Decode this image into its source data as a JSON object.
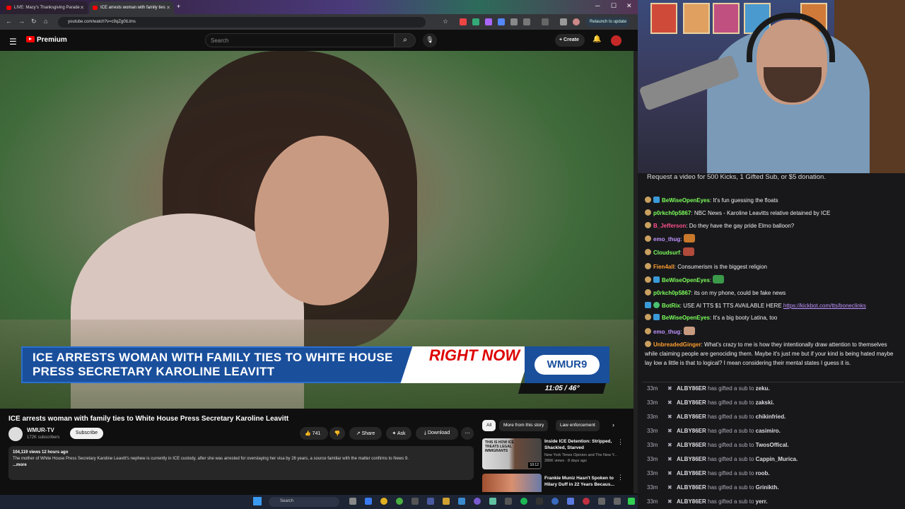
{
  "browser": {
    "tabs": [
      {
        "label": "LIVE: Macy's Thanksgiving Parade"
      },
      {
        "label": "ICE arrests woman with family ties"
      }
    ],
    "url": "youtube.com/watch?v=c9qZg0tLlms",
    "relaunch_label": "Relaunch to update"
  },
  "youtube": {
    "brand": "Premium",
    "search_placeholder": "Search",
    "create_label": "Create",
    "video": {
      "banner_text": "ICE ARRESTS WOMAN WITH FAMILY TIES TO WHITE HOUSE PRESS SECRETARY KAROLINE LEAVITT",
      "right_now": "RIGHT NOW",
      "station": "WMUR9",
      "time_temp": "11:05 / 46°"
    },
    "title": "ICE arrests woman with family ties to White House Press Secretary Karoline Leavitt",
    "channel": {
      "name": "WMUR-TV",
      "subscribers": "172K subscribers",
      "subscribe_label": "Subscribe"
    },
    "actions": {
      "likes": "741",
      "share": "Share",
      "ask": "Ask",
      "download": "Download"
    },
    "description": {
      "meta": "104,119 views  12 hours ago",
      "text": "The mother of White House Press Secretary Karoline Leavitt's nephew is currently in ICE custody, after she was arrested for overstaying her visa by 26 years, a source familiar with the matter confirms to News 9.",
      "more": "...more"
    },
    "chips": [
      "All",
      "More from this story",
      "Law enforcement"
    ],
    "recommendations": [
      {
        "title": "Inside ICE Detention: Stripped, Shackled, Starved",
        "channel": "New York Times Opinion and The New Y...",
        "meta": "286K views · 8 days ago",
        "duration": "10:12",
        "thumb_text": "THIS IS HOW ICE TREATS LEGAL IMMIGRANTS"
      },
      {
        "title": "Frankie Muniz Hasn't Spoken to Hilary Duff in 22 Years Becaus...",
        "channel": "",
        "meta": "",
        "duration": "",
        "thumb_text": ""
      }
    ]
  },
  "taskbar": {
    "search_label": "Search"
  },
  "chat": {
    "promo": "Request a video for 500 Kicks, 1 Gifted Sub, or $5 donation.",
    "messages": [
      {
        "user": "BeWiseOpenEyes",
        "color": "#7cff5a",
        "text": "It's fun guessing the floats"
      },
      {
        "user": "p0rkch0p5867",
        "color": "#7cff5a",
        "text": "NBC News - Karoline Leavitts relative detained by ICE"
      },
      {
        "user": "B_Jefferson",
        "color": "#ff4f8b",
        "text": "Do they have the gay pride Elmo balloon?"
      },
      {
        "user": "emo_thug",
        "color": "#bf94ff",
        "text": ""
      },
      {
        "user": "Cloudsurf",
        "color": "#7cff5a",
        "text": ""
      },
      {
        "user": "Fien4all",
        "color": "#ff9f2e",
        "text": "Consumerism is the biggest religion"
      },
      {
        "user": "BeWiseOpenEyes",
        "color": "#7cff5a",
        "text": ""
      },
      {
        "user": "p0rkch0p5867",
        "color": "#7cff5a",
        "text": "its on my phone, could be fake news"
      },
      {
        "user": "BotRix",
        "color": "#7cff5a",
        "text": "USE AI TTS $1 TTS AVAILABLE HERE ",
        "link": "https://kickbot.com/tts/boneclinks"
      },
      {
        "user": "BeWiseOpenEyes",
        "color": "#7cff5a",
        "text": "It's a big booty Latina, too"
      },
      {
        "user": "emo_thug",
        "color": "#bf94ff",
        "text": ""
      },
      {
        "user": "UnbreadedGinger",
        "color": "#ff9f2e",
        "text": "What's crazy to me is how they intentionally draw attention to themselves while claiming people are genociding them. Maybe it's just me but if your kind is being hated maybe lay low a little is that to logical? I mean considering their mental states I guess it is."
      }
    ],
    "events": [
      {
        "time": "33m",
        "gifter": "ALBY86ER",
        "action": "has gifted a sub to",
        "target": "zeku."
      },
      {
        "time": "33m",
        "gifter": "ALBY86ER",
        "action": "has gifted a sub to",
        "target": "zakski."
      },
      {
        "time": "33m",
        "gifter": "ALBY86ER",
        "action": "has gifted a sub to",
        "target": "chikinfried."
      },
      {
        "time": "33m",
        "gifter": "ALBY86ER",
        "action": "has gifted a sub to",
        "target": "casimiro."
      },
      {
        "time": "33m",
        "gifter": "ALBY86ER",
        "action": "has gifted a sub to",
        "target": "TwosOffical."
      },
      {
        "time": "33m",
        "gifter": "ALBY86ER",
        "action": "has gifted a sub to",
        "target": "Cappin_Murica."
      },
      {
        "time": "33m",
        "gifter": "ALBY86ER",
        "action": "has gifted a sub to",
        "target": "roob."
      },
      {
        "time": "33m",
        "gifter": "ALBY86ER",
        "action": "has gifted a sub to",
        "target": "Grinikth."
      },
      {
        "time": "33m",
        "gifter": "ALBY86ER",
        "action": "has gifted a sub to",
        "target": "yerr."
      }
    ]
  }
}
